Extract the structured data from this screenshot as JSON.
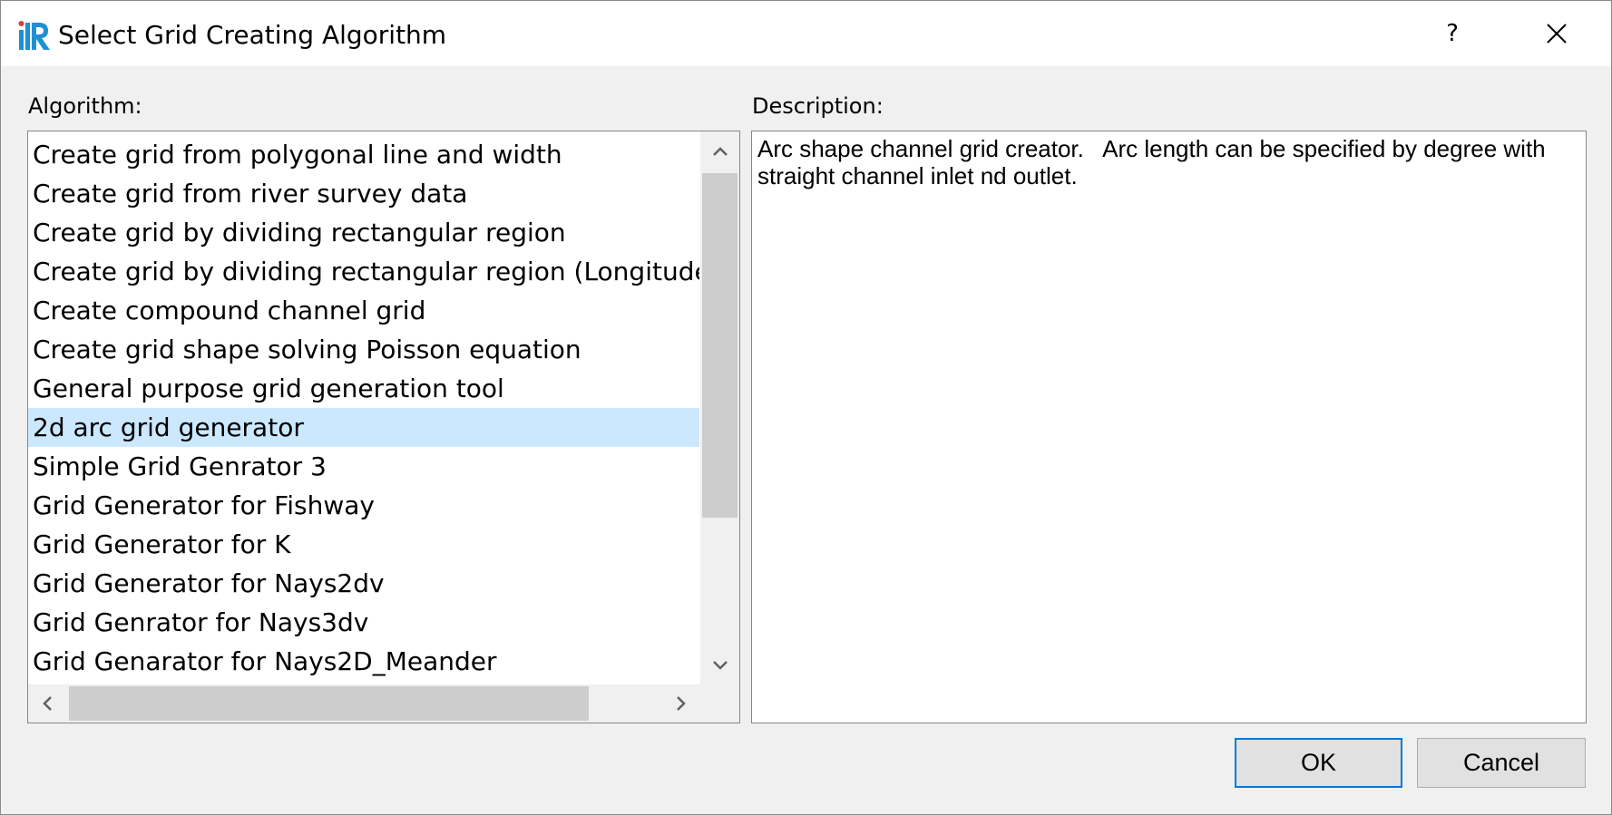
{
  "window": {
    "title": "Select Grid Creating Algorithm",
    "help_label": "?",
    "logo_icon": "iric-logo-icon",
    "close_icon": "close-icon"
  },
  "algorithm": {
    "label": "Algorithm:",
    "selected_index": 7,
    "items": [
      "Create grid from polygonal line and width",
      "Create grid from river survey data",
      "Create grid by dividing rectangular region",
      "Create grid by dividing rectangular region (Longitude-La",
      "Create compound channel grid",
      "Create grid shape solving Poisson equation",
      "General purpose grid generation tool",
      "2d arc grid generator",
      "Simple Grid Genrator 3",
      "Grid Generator for Fishway",
      "Grid Generator for K",
      "Grid Generator for Nays2dv",
      "Grid Genrator for Nays3dv",
      "Grid Genarator for Nays2D_Meander"
    ]
  },
  "description": {
    "label": "Description:",
    "text": "Arc shape channel grid creator.   Arc length can be specified by degree with\nstraight channel inlet nd outlet."
  },
  "buttons": {
    "ok": "OK",
    "cancel": "Cancel"
  },
  "colors": {
    "selection": "#cce8ff",
    "default_button_border": "#0078d7",
    "logo_blue": "#1e90d6"
  },
  "icons": {
    "scroll_up": "chevron-up-icon",
    "scroll_down": "chevron-down-icon",
    "scroll_left": "chevron-left-icon",
    "scroll_right": "chevron-right-icon"
  }
}
